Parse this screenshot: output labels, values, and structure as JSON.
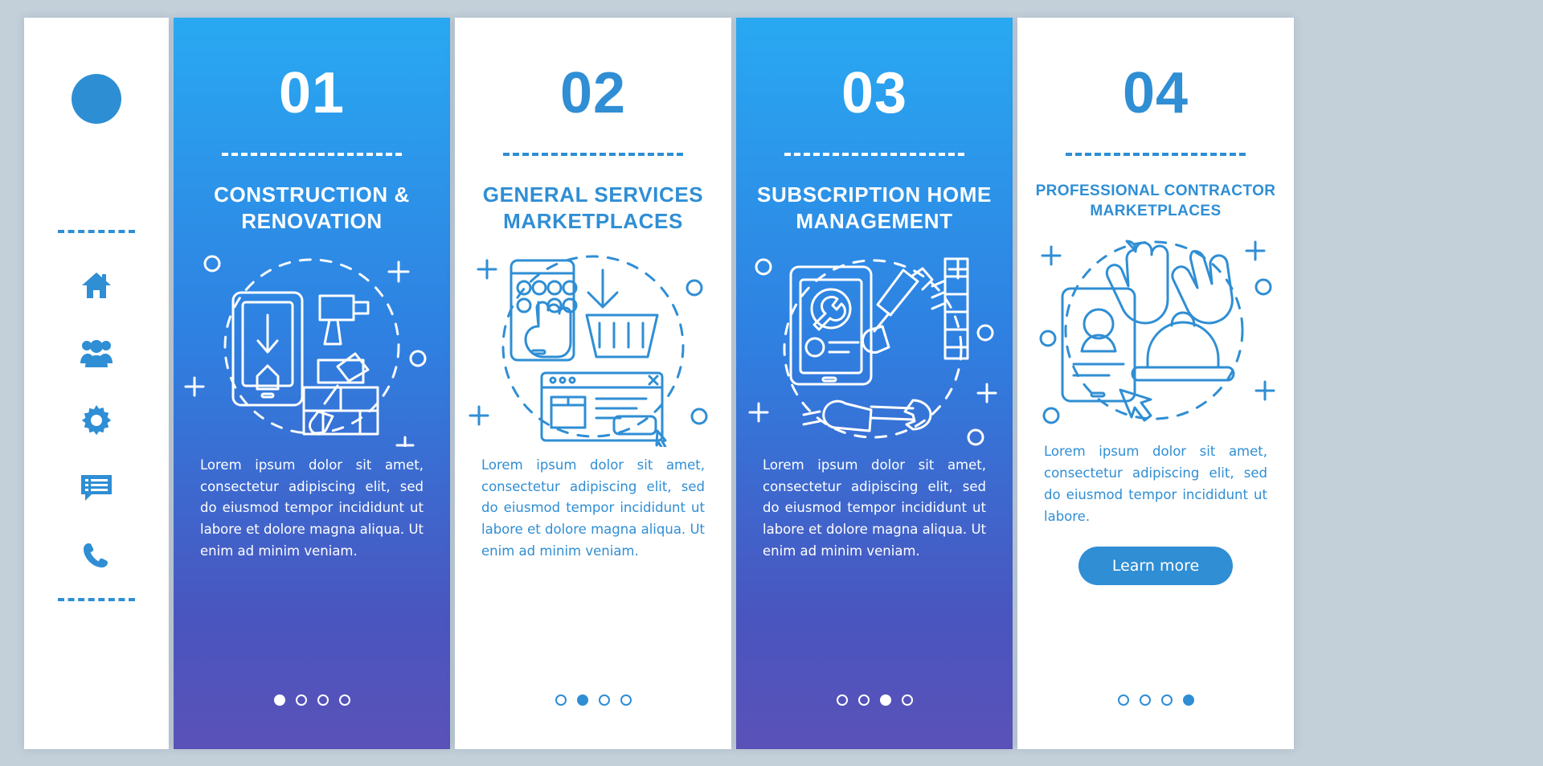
{
  "page": {
    "background_color": "#c3d0da",
    "accent_color": "#2f8ed4",
    "gradient_from": "#29a9f2",
    "gradient_to": "#5a52b8"
  },
  "sidebar": {
    "logo_name": "logo-circle",
    "icons": [
      {
        "name": "home-icon",
        "label": "Home"
      },
      {
        "name": "people-group-icon",
        "label": "Team"
      },
      {
        "name": "gear-icon",
        "label": "Settings"
      },
      {
        "name": "chat-list-icon",
        "label": "Messages"
      },
      {
        "name": "phone-icon",
        "label": "Call"
      }
    ]
  },
  "cards": [
    {
      "number": "01",
      "title": "CONSTRUCTION & RENOVATION",
      "body": "Lorem ipsum dolor sit amet, consectetur adipiscing elit, sed do eiusmod tempor incididunt ut labore et dolore magna aliqua. Ut enim ad minim veniam.",
      "theme": "blue",
      "illustration": "drill-phone-trowel-bricks",
      "dots": {
        "count": 4,
        "active_index": 0
      },
      "button": null
    },
    {
      "number": "02",
      "title": "GENERAL SERVICES MARKETPLACES",
      "body": "Lorem ipsum dolor sit amet, consectetur adipiscing elit, sed do eiusmod tempor incididunt ut labore et dolore magna aliqua. Ut enim ad minim veniam.",
      "theme": "white",
      "illustration": "phone-basket-browser-pay",
      "dots": {
        "count": 4,
        "active_index": 1
      },
      "button": null
    },
    {
      "number": "03",
      "title": "SUBSCRIPTION HOME MANAGEMENT",
      "body": "Lorem ipsum dolor sit amet, consectetur adipiscing elit, sed do eiusmod tempor incididunt ut labore et dolore magna aliqua. Ut enim ad minim veniam.",
      "theme": "blue",
      "illustration": "phone-hammer-wrench",
      "dots": {
        "count": 4,
        "active_index": 2
      },
      "button": null
    },
    {
      "number": "04",
      "title": "PROFESSIONAL CONTRACTOR MARKETPLACES",
      "body": "Lorem ipsum dolor sit amet, consectetur adipiscing elit, sed do eiusmod tempor incididunt ut labore.",
      "theme": "white",
      "illustration": "gloves-helmet-profile",
      "dots": {
        "count": 4,
        "active_index": 3
      },
      "button": {
        "label": "Learn more"
      }
    }
  ]
}
